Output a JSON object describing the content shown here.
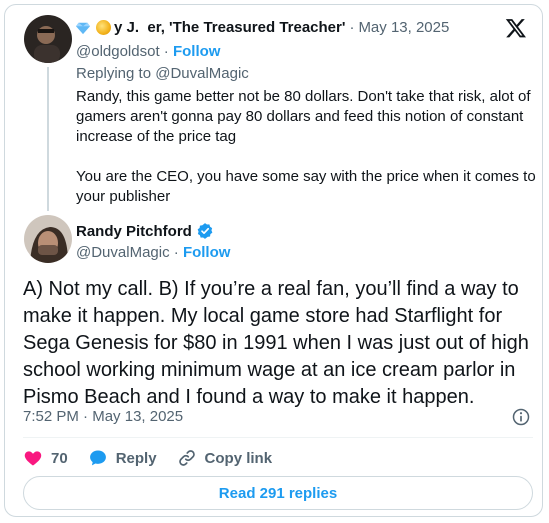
{
  "reply_tweet": {
    "display_name": "y J.  er, 'The Treasured Treacher'",
    "date": "May 13, 2025",
    "handle": "@oldgoldsot",
    "follow_label": "Follow",
    "replying_to_prefix": "Replying to",
    "replying_to_handle": "@DuvalMagic",
    "text": "Randy, this game better not be 80 dollars. Don't take that risk, alot of gamers aren't gonna pay 80 dollars and feed this notion of constant increase of the price tag\n\nYou are the CEO, you have some say with the price when it comes to your publisher"
  },
  "main_tweet": {
    "display_name": "Randy Pitchford",
    "handle": "@DuvalMagic",
    "follow_label": "Follow",
    "text": "A) Not my call. B) If you’re a real fan, you’ll find a way to make it happen. My local game store had Starflight for Sega Genesis for $80 in 1991 when I was just out of high school working minimum wage at an ice cream parlor in Pismo Beach and I found a way to make it happen.",
    "time": "7:52 PM",
    "date": "May 13, 2025"
  },
  "actions": {
    "like_count": "70",
    "reply_label": "Reply",
    "copy_link_label": "Copy link"
  },
  "read_replies_label": "Read 291 replies",
  "colors": {
    "accent": "#1d9bf0",
    "like": "#f91880",
    "muted_text": "#536471",
    "border": "#cfd9de"
  },
  "icons": [
    "x-logo-icon",
    "gem-icon",
    "coin-icon",
    "verified-badge-icon",
    "info-icon",
    "heart-icon",
    "reply-bubble-icon",
    "link-icon"
  ]
}
